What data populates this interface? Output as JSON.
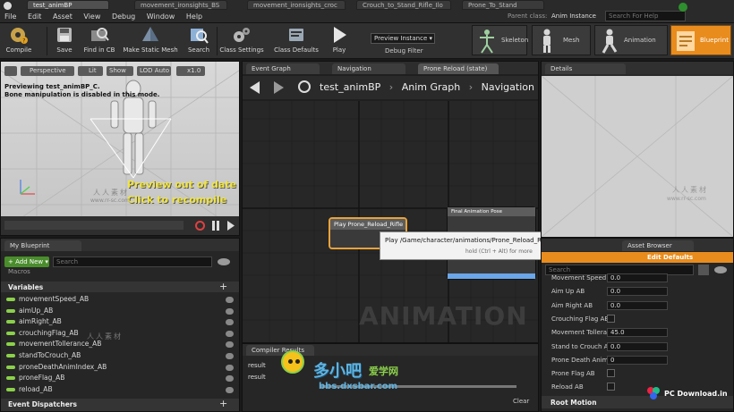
{
  "window": {
    "title": "test_animBP",
    "parent_class_label": "Parent class:",
    "parent_class_value": "Anim Instance",
    "search_help_placeholder": "Search For Help"
  },
  "menu": [
    "File",
    "Edit",
    "Asset",
    "View",
    "Debug",
    "Window",
    "Help"
  ],
  "doc_tabs": [
    "test_animBP",
    "movement_ironsights_BS",
    "movement_ironsights_croc",
    "Crouch_to_Stand_Rifle_Ilo",
    "Prone_To_Stand"
  ],
  "toolbar": {
    "compile": "Compile",
    "save": "Save",
    "find_in_cb": "Find in CB",
    "make_static_mesh": "Make Static Mesh",
    "search": "Search",
    "class_settings": "Class Settings",
    "class_defaults": "Class Defaults",
    "play": "Play",
    "debug_instance": "Preview Instance ▾",
    "debug_filter": "Debug Filter",
    "mode_skeleton": "Skeleton",
    "mode_mesh": "Mesh",
    "mode_animation": "Animation",
    "mode_blueprint": "Blueprint"
  },
  "viewport": {
    "perspective": "Perspective",
    "lit": "Lit",
    "show": "Show",
    "lod": "LOD Auto",
    "speed": "x1.0",
    "info_line1": "Previewing test_animBP_C.",
    "info_line2": "Bone manipulation is disabled in this mode.",
    "warning_line1": "Preview out of date",
    "warning_line2": "Click to recompile"
  },
  "graph": {
    "tabs": [
      "Event Graph",
      "Navigation",
      "Prone Reload (state)"
    ],
    "breadcrumb": [
      "test_animBP",
      "Anim Graph",
      "Navigation"
    ],
    "node_play": "Play Prone_Reload_Rifle",
    "node_final": "Final Animation Pose",
    "tooltip_line1": "Play /Game/character/animations/Prone_Reload_Rifle.Prone_Reload_Rifle",
    "tooltip_line2": "hold (Ctrl + Alt) for more",
    "watermark": "ANIMATION"
  },
  "my_blueprint": {
    "title": "My Blueprint",
    "add_new": "+ Add New ▾",
    "search_placeholder": "Search",
    "section_macros": "Macros",
    "section_variables": "Variables",
    "variables": [
      "movementSpeed_AB",
      "aimUp_AB",
      "aimRight_AB",
      "crouchingFlag_AB",
      "movementTollerance_AB",
      "standToCrouch_AB",
      "proneDeathAnimIndex_AB",
      "proneFlag_AB",
      "reload_AB"
    ],
    "section_event_dispatchers": "Event Dispatchers"
  },
  "compiler": {
    "title": "Compiler Results",
    "lines": [
      "result",
      "result"
    ],
    "clear": "Clear"
  },
  "details": {
    "title": "Details",
    "asset_browser": "Asset Browser",
    "edit_defaults": "Edit Defaults",
    "search_placeholder": "Search",
    "rows": [
      {
        "label": "Movement Speed AB",
        "type": "field",
        "value": "0.0"
      },
      {
        "label": "Aim Up AB",
        "type": "field",
        "value": "0.0"
      },
      {
        "label": "Aim Right AB",
        "type": "field",
        "value": "0.0"
      },
      {
        "label": "Crouching Flag AB",
        "type": "check",
        "value": ""
      },
      {
        "label": "Movement Tollera",
        "type": "field",
        "value": "45.0"
      },
      {
        "label": "Stand to Crouch A",
        "type": "field",
        "value": "0.0"
      },
      {
        "label": "Prone Death Anim",
        "type": "field",
        "value": "0"
      },
      {
        "label": "Prone Flag AB",
        "type": "check",
        "value": ""
      },
      {
        "label": "Reload AB",
        "type": "check",
        "value": ""
      }
    ],
    "root_motion": "Root Motion"
  },
  "watermarks": {
    "rrsc_cn": "人人素材",
    "rrsc_url": "www.rr-sc.com",
    "dxsbar": "多小吧",
    "dxsbar_sub": "爱学网",
    "dxsbar_url": "bbs.dxsbar.com",
    "pc_download": "PC Download.in"
  },
  "colors": {
    "accent_orange": "#e88c1e",
    "warning_yellow": "#f0e442",
    "add_green": "#4a8d2c",
    "var_green": "#8bd04b"
  }
}
